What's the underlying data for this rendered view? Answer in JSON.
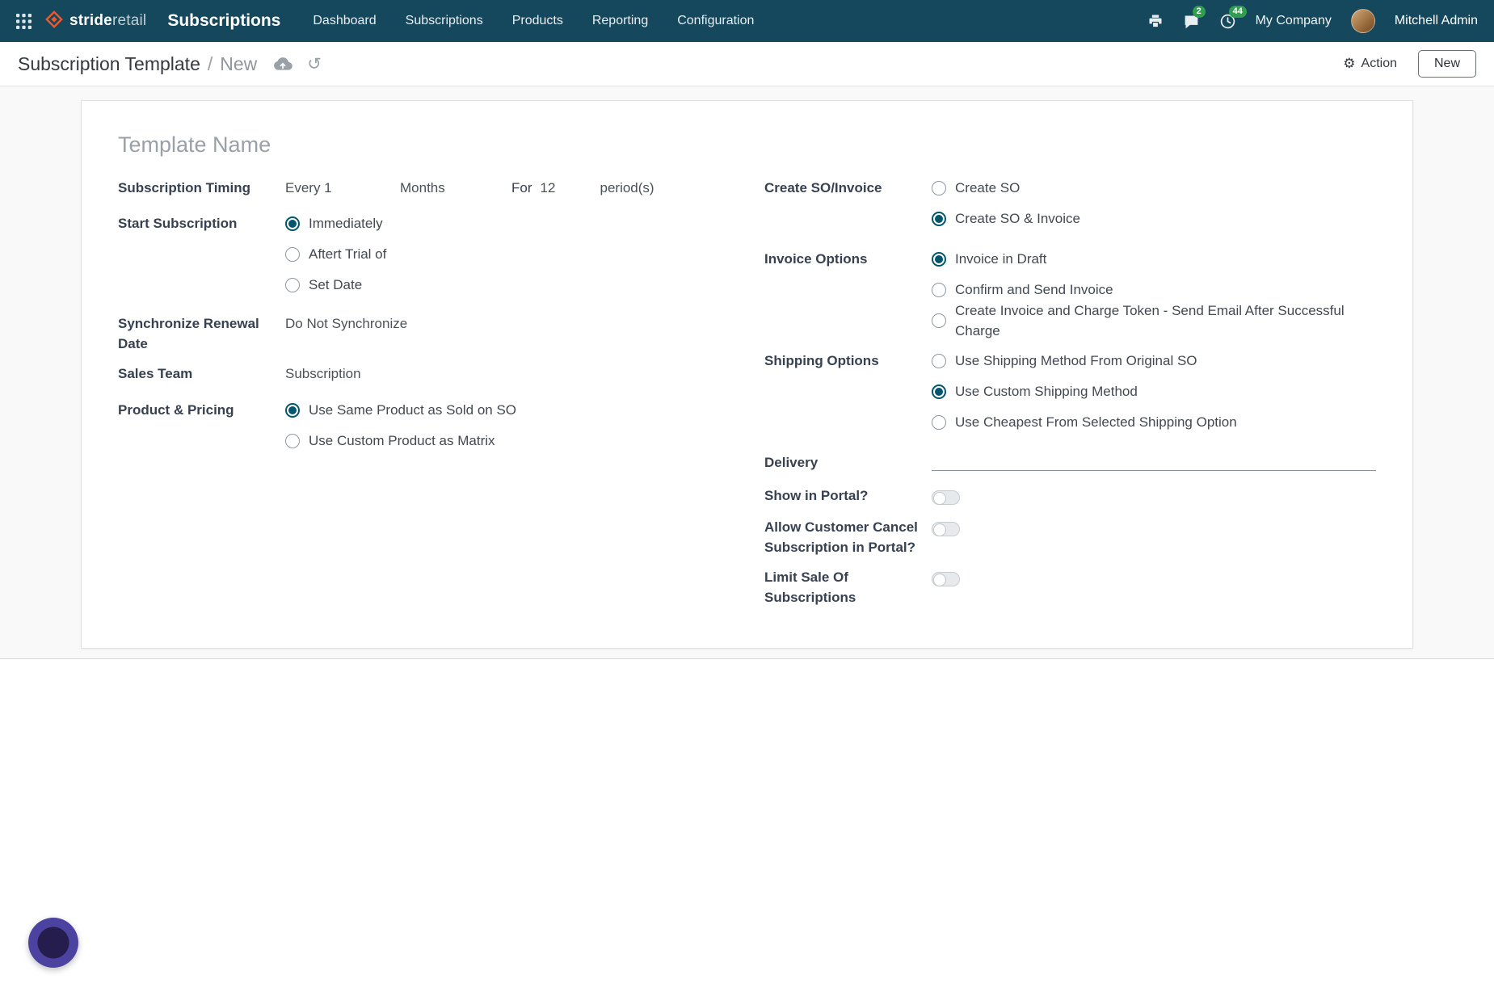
{
  "icons": {
    "gear": "⚙",
    "undo": "↺"
  },
  "navbar": {
    "logo_bold": "stride",
    "logo_light": "retail",
    "app_name": "Subscriptions",
    "menu": [
      {
        "label": "Dashboard"
      },
      {
        "label": "Subscriptions"
      },
      {
        "label": "Products"
      },
      {
        "label": "Reporting"
      },
      {
        "label": "Configuration"
      }
    ],
    "messages_badge": "2",
    "activities_badge": "44",
    "company": "My Company",
    "user": "Mitchell Admin"
  },
  "control_panel": {
    "breadcrumb_root": "Subscription Template",
    "breadcrumb_separator": "/",
    "breadcrumb_current": "New",
    "action_label": "Action",
    "new_button": "New"
  },
  "form": {
    "name_placeholder": "Template Name",
    "timing": {
      "label": "Subscription Timing",
      "every": "Every 1",
      "unit": "Months",
      "for_label": "For",
      "periods": "12",
      "period_suffix": "period(s)"
    },
    "start": {
      "label": "Start Subscription",
      "options": [
        {
          "label": "Immediately",
          "selected": true
        },
        {
          "label": "Aftert Trial of",
          "selected": false
        },
        {
          "label": "Set Date",
          "selected": false
        }
      ]
    },
    "sync": {
      "label": "Synchronize Renewal Date",
      "value": "Do Not Synchronize"
    },
    "sales_team": {
      "label": "Sales Team",
      "value": "Subscription"
    },
    "product_pricing": {
      "label": "Product & Pricing",
      "options": [
        {
          "label": "Use Same Product as Sold on SO",
          "selected": true
        },
        {
          "label": "Use Custom Product as Matrix",
          "selected": false
        }
      ]
    },
    "create_so": {
      "label": "Create SO/Invoice",
      "options": [
        {
          "label": "Create SO",
          "selected": false
        },
        {
          "label": "Create SO & Invoice",
          "selected": true
        }
      ]
    },
    "invoice_options": {
      "label": "Invoice Options",
      "options": [
        {
          "label": "Invoice in Draft",
          "selected": true
        },
        {
          "label": "Confirm and Send Invoice",
          "selected": false
        },
        {
          "label": "Create Invoice and Charge Token - Send Email After Successful Charge",
          "selected": false
        }
      ]
    },
    "shipping_options": {
      "label": "Shipping Options",
      "options": [
        {
          "label": "Use Shipping Method From Original SO",
          "selected": false
        },
        {
          "label": "Use Custom Shipping Method",
          "selected": true
        },
        {
          "label": "Use Cheapest From Selected Shipping Option",
          "selected": false
        }
      ]
    },
    "delivery": {
      "label": "Delivery",
      "value": ""
    },
    "toggles": [
      {
        "label": "Show in Portal?",
        "on": false
      },
      {
        "label": "Allow Customer Cancel Subscription in Portal?",
        "on": false
      },
      {
        "label": "Limit Sale Of Subscriptions",
        "on": false
      }
    ]
  }
}
